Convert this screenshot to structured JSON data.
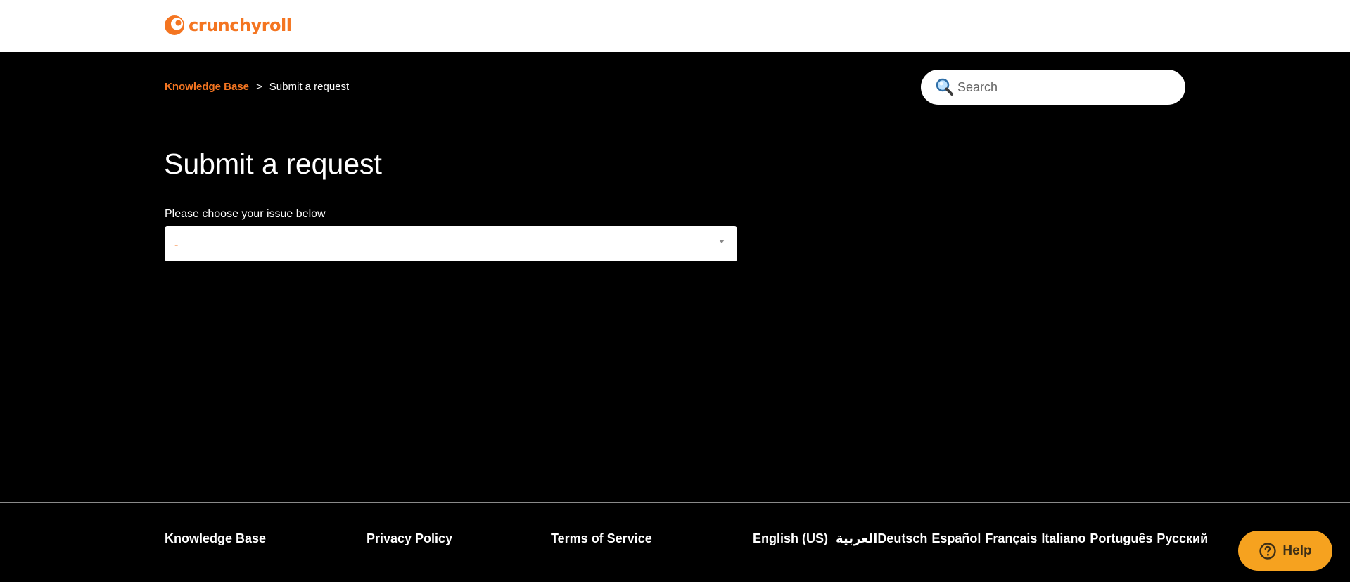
{
  "header": {
    "logo_text": "crunchyroll",
    "logo_icon": "crunchyroll-logo-icon",
    "brand_color": "#f47521"
  },
  "breadcrumb": {
    "home_label": "Knowledge Base",
    "separator": ">",
    "current_label": "Submit a request"
  },
  "search": {
    "placeholder": "Search",
    "icon": "search-icon"
  },
  "main": {
    "title": "Submit a request",
    "issue_label": "Please choose your issue below",
    "issue_selected": "-"
  },
  "footer": {
    "links": {
      "knowledge_base": "Knowledge Base",
      "privacy": "Privacy Policy",
      "terms": "Terms of Service"
    },
    "languages": {
      "english": "English (US)",
      "arabic": "العربية",
      "german": "Deutsch",
      "spanish": "Español",
      "french": "Français",
      "italian": "Italiano",
      "portuguese": "Português",
      "russian": "Русский"
    }
  },
  "help_widget": {
    "label": "Help",
    "icon": "question-circle-icon",
    "color": "#f6a21f"
  }
}
